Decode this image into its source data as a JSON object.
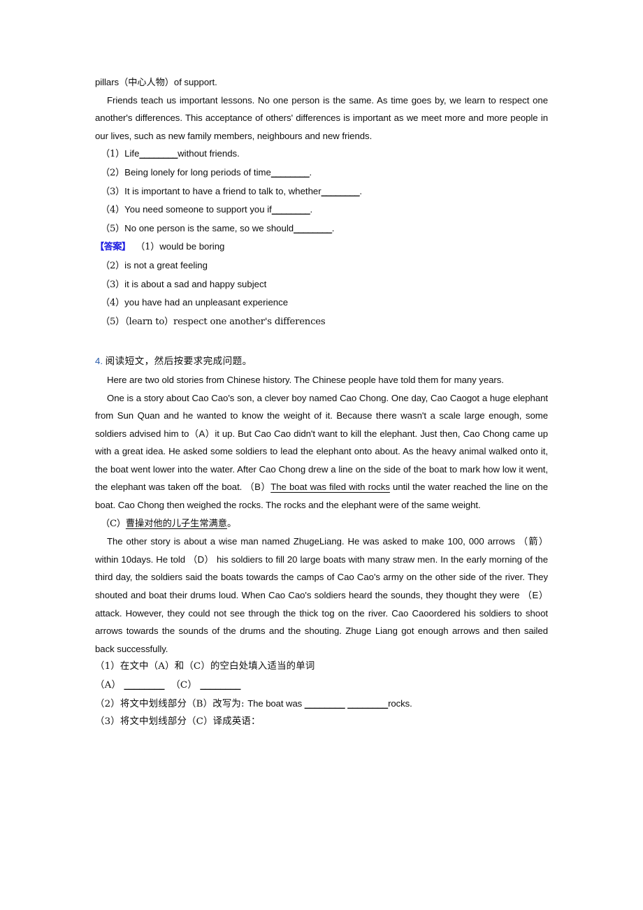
{
  "document": {
    "type": "exam-worksheet-page",
    "language": "zh-en-mixed",
    "accent_color": "#1a1ae0",
    "section_number_color": "#2a5caa"
  },
  "passage_top": {
    "line1": "pillars（中心人物）of support.",
    "paragraph": "Friends teach us important lessons. No one person is the same. As time goes by, we learn to respect one another's differences. This acceptance of others' differences is important as we meet more and more people in our lives, such as new family members, neighbours and new friends."
  },
  "questions_top": [
    {
      "num": "（1）",
      "pre": "Life",
      "blank": "________",
      "post": "without friends."
    },
    {
      "num": "（2）",
      "pre": "Being lonely for long periods of time",
      "blank": "________",
      "post": "."
    },
    {
      "num": "（3）",
      "pre": "It is important to have a friend to talk to, whether",
      "blank": "________",
      "post": "."
    },
    {
      "num": "（4）",
      "pre": "You need someone to support you if",
      "blank": "________",
      "post": "."
    },
    {
      "num": "（5）",
      "pre": "No one person is the same, so we should",
      "blank": "________",
      "post": "."
    }
  ],
  "answers_top": {
    "label": "【答案】",
    "items": [
      {
        "num": "（1）",
        "text": "would be boring"
      },
      {
        "num": "（2）",
        "text": "is not a great feeling"
      },
      {
        "num": "（3）",
        "text": "it is about a sad and happy subject"
      },
      {
        "num": "（4）",
        "text": "you have had an unpleasant experience"
      },
      {
        "num": "（5）",
        "text": "（learn to）respect one another's differences"
      }
    ]
  },
  "section4": {
    "number": "4.",
    "heading": "阅读短文，然后按要求完成问题。",
    "intro": "Here are two old stories from Chinese history. The Chinese people have told them for many years.",
    "story1_part1": "One is a story about Cao Cao's son, a clever boy named Cao Chong. One day, Cao Caogot a huge elephant from Sun Quan and he wanted to know the weight of it. Because there wasn't a scale large enough, some soldiers advised him to（A）it up. But Cao Cao didn't want to kill the elephant. Just then, Cao Chong came up with a great idea. He asked some soldiers to lead the elephant onto about. As the heavy animal walked onto it, the boat went lower into the water. After Cao Chong drew a line on the side of the boat to mark how low it went, the elephant was taken off the boat. （B）",
    "story1_underlined": "The boat was filed with rocks",
    "story1_part2": " until the water reached the line on the boat. Cao Chong then weighed the rocks. The rocks and the elephant were of the same weight.",
    "story1_c_label": "（C）",
    "story1_c_underlined": "曹操对他的儿子生常满意",
    "story1_c_period": "。",
    "story2": "The other story is about a wise man named ZhugeLiang. He was asked to make 100, 000 arrows （箭）within 10days. He told （D） his soldiers to fill 20 large boats with many straw men. In the early morning of the third day, the soldiers said the boats towards the camps of Cao Cao's army on the other side of the river. They shouted and boat their drums loud. When Cao Cao's soldiers heard the sounds, they thought they were （E）attack. However, they could not see through the thick tog on the river. Cao Caoordered his soldiers to shoot arrows towards the sounds of the drums and the shouting. Zhuge Liang got enough arrows and then sailed back successfully."
  },
  "questions_bottom": {
    "q1": "（1）在文中（A）和（C）的空白处填入适当的单词",
    "q1_a_label": "（A）",
    "q1_a_blank": "________",
    "q1_c_label": "（C）",
    "q1_c_blank": "________",
    "q2_pre": "（2）将文中划线部分（B）改写为: ",
    "q2_en": "The boat was ",
    "q2_blank1": "________",
    "q2_blank2": "________",
    "q2_tail": "rocks.",
    "q3": "（3）将文中划线部分（C）译成英语："
  }
}
